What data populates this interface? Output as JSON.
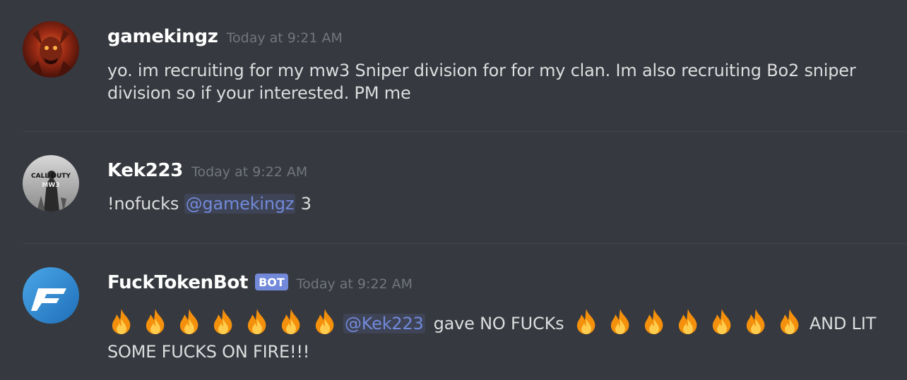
{
  "messages": [
    {
      "username": "gamekingz",
      "timestamp": "Today at 9:21 AM",
      "avatar_icon": "demon-avatar-icon",
      "text": "yo. im recruiting for my mw3 Sniper division for for my clan. Im also recruiting Bo2 sniper division so if your interested. PM me"
    },
    {
      "username": "Kek223",
      "timestamp": "Today at 9:22 AM",
      "avatar_icon": "call-of-duty-mw3-avatar-icon",
      "avatar_text": "CALL·DUTY MW3",
      "text_before": "!nofucks ",
      "mention": "@gamekingz",
      "text_after": " 3"
    },
    {
      "username": "FuckTokenBot",
      "bot_tag": "BOT",
      "timestamp": "Today at 9:22 AM",
      "avatar_icon": "fucktoken-f-logo-icon",
      "mention": "@Kek223",
      "text_middle": "gave NO FUCKs",
      "text_end": "AND LIT SOME FUCKS ON FIRE!!!",
      "emoji": "fire-emoji-icon",
      "emoji_count_before": 7,
      "emoji_count_after": 7
    }
  ],
  "colors": {
    "background": "#36393f",
    "username": "#ffffff",
    "timestamp": "#72767d",
    "text": "#dcddde",
    "mention": "#7289da",
    "bot_tag": "#7289da"
  }
}
